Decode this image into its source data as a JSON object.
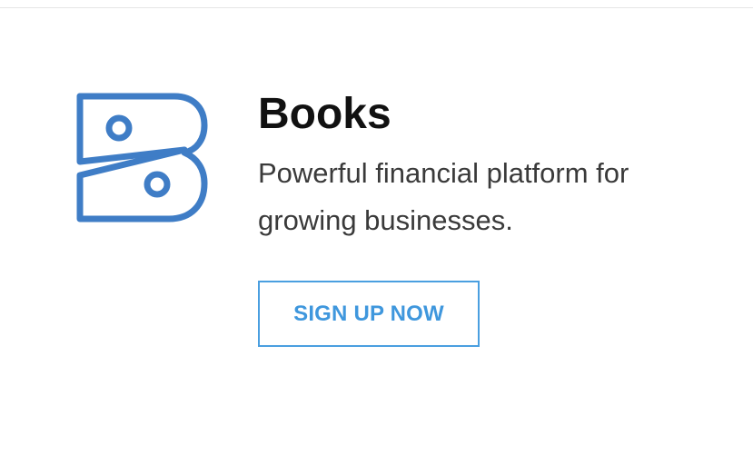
{
  "product": {
    "title": "Books",
    "tagline": "Powerful financial platform for growing businesses.",
    "logo_icon": "zoho-books-logo-icon",
    "brand_color": "#3f7dc6"
  },
  "cta": {
    "signup_label": "SIGN UP NOW",
    "color": "#4a9fe0"
  }
}
